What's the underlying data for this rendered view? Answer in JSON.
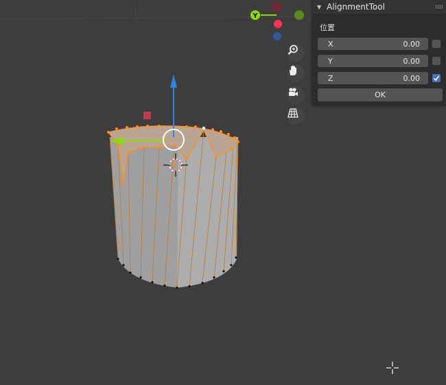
{
  "panel": {
    "title": "AlignmentTool",
    "section": "位置",
    "fields": [
      {
        "label": "X",
        "value": "0.00",
        "checked": false
      },
      {
        "label": "Y",
        "value": "0.00",
        "checked": false
      },
      {
        "label": "Z",
        "value": "0.00",
        "checked": true
      }
    ],
    "ok_label": "OK"
  },
  "gizmo": {
    "y_axis_label": "Y",
    "colors": {
      "x_axis": "#ff3352",
      "y_axis": "#8bdc00",
      "z_axis": "#2f83e3",
      "y_negative": "#5a8a1d",
      "z_negative": "#2f5a9e"
    }
  },
  "navigation": {
    "icons": [
      "zoom-icon",
      "hand-pan-icon",
      "camera-icon",
      "perspective-grid-icon"
    ]
  },
  "colors": {
    "viewport_background": "#3d3d3d",
    "selection": "#ff8c1a",
    "checkbox_checked": "#4772b3"
  }
}
